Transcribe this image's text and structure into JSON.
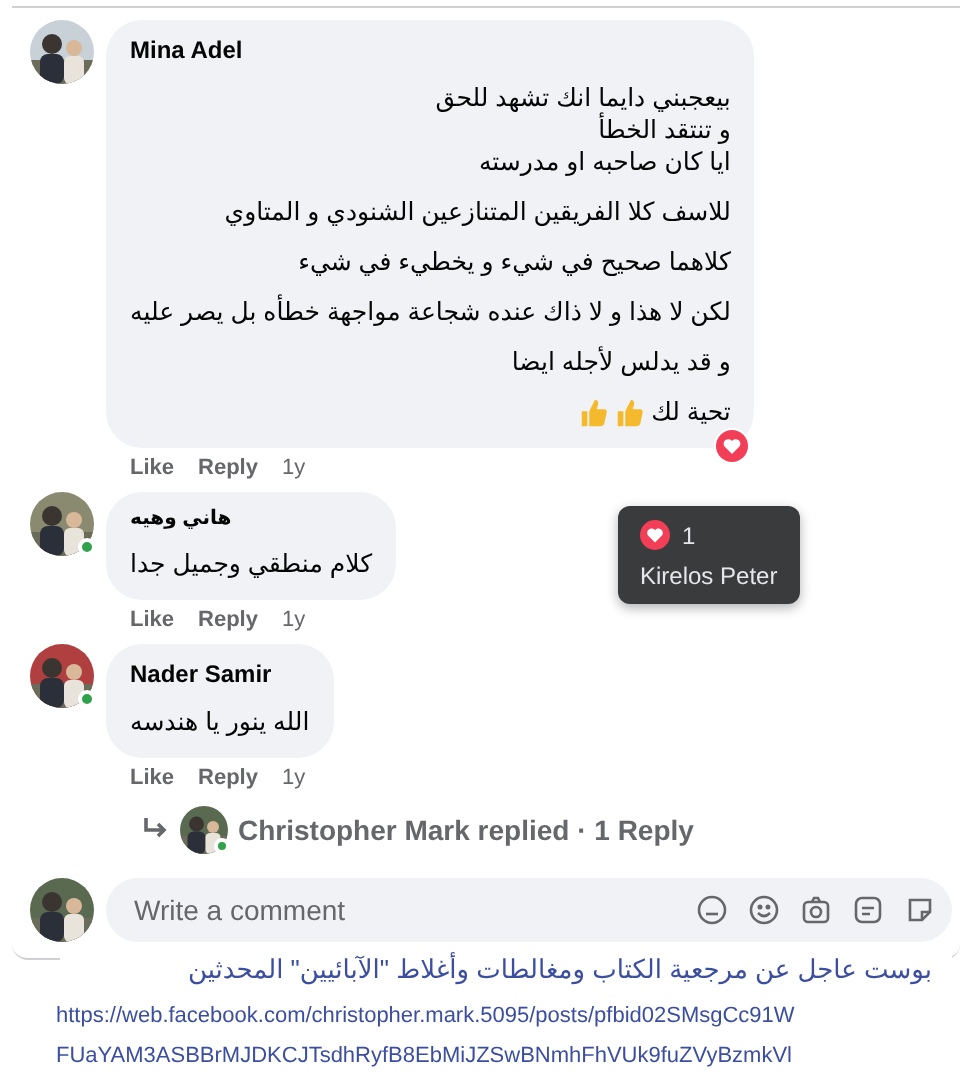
{
  "comments": [
    {
      "author": "Mina Adel",
      "online": false,
      "paragraphs": [
        [
          "بيعجبني دايما انك تشهد للحق",
          "و تنتقد الخطأ",
          "ايا كان صاحبه او مدرسته"
        ],
        [
          "للاسف كلا الفريقين المتنازعين الشنودي و المتاوي"
        ],
        [
          "كلاهما صحيح في شيء و يخطيء في شيء"
        ],
        [
          "لكن لا هذا و لا ذاك عنده شجاعة مواجهة خطأه بل يصر عليه"
        ],
        [
          "و قد يدلس لأجله ايضا"
        ],
        [
          "تحية لك"
        ]
      ],
      "reacted": true,
      "actions": {
        "like": "Like",
        "reply": "Reply",
        "time": "1y"
      },
      "tooltip": {
        "count": "1",
        "name": "Kirelos Peter"
      }
    },
    {
      "author": "هاني وهيه",
      "online": true,
      "paragraphs": [
        [
          "كلام منطقي وجميل جدا"
        ]
      ],
      "reacted": false,
      "actions": {
        "like": "Like",
        "reply": "Reply",
        "time": "1y"
      }
    },
    {
      "author": "Nader Samir",
      "online": true,
      "paragraphs": [
        [
          "الله ينور يا هندسه"
        ]
      ],
      "reacted": false,
      "actions": {
        "like": "Like",
        "reply": "Reply",
        "time": "1y"
      }
    }
  ],
  "replies_link": {
    "text": "Christopher Mark replied · 1 Reply",
    "online": true
  },
  "composer": {
    "placeholder": "Write a comment"
  },
  "overlay_link": "بوست عاجل عن مرجعية الكتاب ومغالطات وأغلاط \"الآبائيين\" المحدثين",
  "url_lines": [
    "https://web.facebook.com/christopher.mark.5095/posts/pfbid02SMsgCc91W",
    "FUaYAM3ASBBrMJDKCJTsdhRyfB8EbMiJZSwBNmhFhVUk9fuZVyBzmkVl"
  ]
}
